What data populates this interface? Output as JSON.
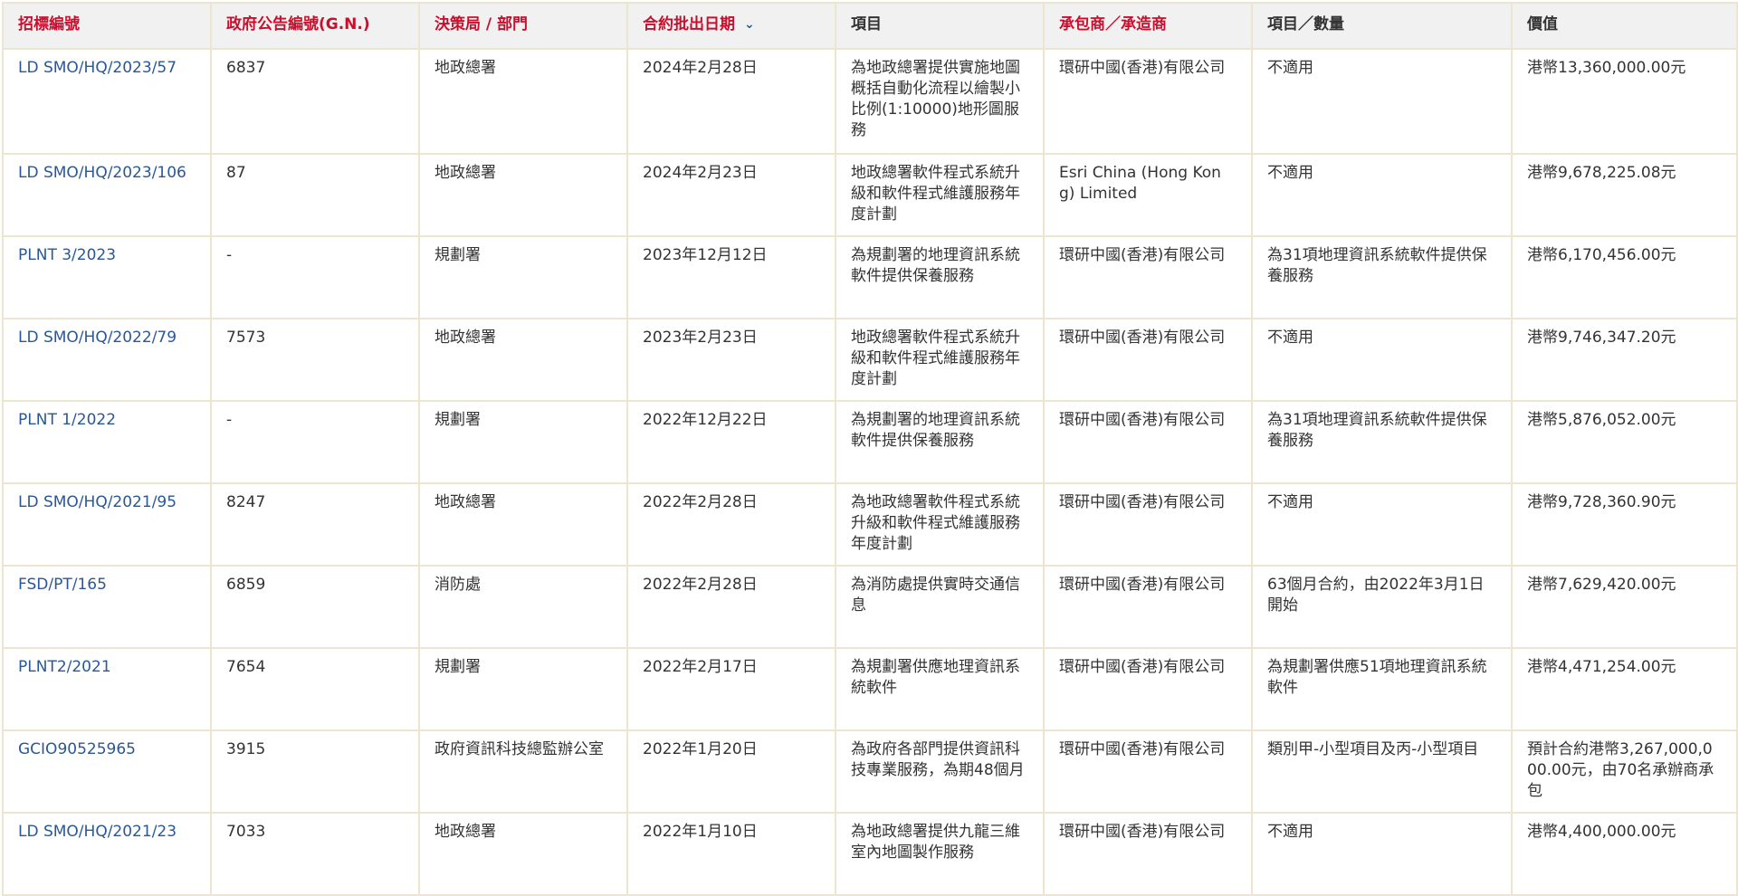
{
  "columns": [
    {
      "label": "招標編號",
      "color": "red"
    },
    {
      "label": "政府公告編號(G.N.)",
      "color": "red"
    },
    {
      "label": "決策局 / 部門",
      "color": "red"
    },
    {
      "label": "合約批出日期",
      "color": "red",
      "sort": "desc"
    },
    {
      "label": "項目",
      "color": "dark"
    },
    {
      "label": "承包商／承造商",
      "color": "red"
    },
    {
      "label": "項目／數量",
      "color": "dark"
    },
    {
      "label": "價值",
      "color": "dark"
    }
  ],
  "sort_indicator": "⌄",
  "rows": [
    [
      "LD SMO/HQ/2023/57",
      "6837",
      "地政總署",
      "2024年2月28日",
      "為地政總署提供實施地圖概括自動化流程以繪製小比例(1:10000)地形圖服務",
      "環研中國(香港)有限公司",
      "不適用",
      "港幣13,360,000.00元"
    ],
    [
      "LD SMO/HQ/2023/106",
      "87",
      "地政總署",
      "2024年2月23日",
      "地政總署軟件程式系統升級和軟件程式維護服務年度計劃",
      "Esri China (Hong Kong) Limited",
      "不適用",
      "港幣9,678,225.08元"
    ],
    [
      "PLNT 3/2023",
      "-",
      "規劃署",
      "2023年12月12日",
      "為規劃署的地理資訊系統軟件提供保養服務",
      "環研中國(香港)有限公司",
      "為31項地理資訊系統軟件提供保養服務",
      "港幣6,170,456.00元"
    ],
    [
      "LD SMO/HQ/2022/79",
      "7573",
      "地政總署",
      "2023年2月23日",
      "地政總署軟件程式系統升級和軟件程式維護服務年度計劃",
      "環研中國(香港)有限公司",
      "不適用",
      "港幣9,746,347.20元"
    ],
    [
      "PLNT 1/2022",
      "-",
      "規劃署",
      "2022年12月22日",
      "為規劃署的地理資訊系統軟件提供保養服務",
      "環研中國(香港)有限公司",
      "為31項地理資訊系統軟件提供保養服務",
      "港幣5,876,052.00元"
    ],
    [
      "LD SMO/HQ/2021/95",
      "8247",
      "地政總署",
      "2022年2月28日",
      "為地政總署軟件程式系統升級和軟件程式維護服務年度計劃",
      "環研中國(香港)有限公司",
      "不適用",
      "港幣9,728,360.90元"
    ],
    [
      "FSD/PT/165",
      "6859",
      "消防處",
      "2022年2月28日",
      "為消防處提供實時交通信息",
      "環研中國(香港)有限公司",
      "63個月合約，由2022年3月1日開始",
      "港幣7,629,420.00元"
    ],
    [
      "PLNT2/2021",
      "7654",
      "規劃署",
      "2022年2月17日",
      "為規劃署供應地理資訊系統軟件",
      "環研中國(香港)有限公司",
      "為規劃署供應51項地理資訊系統軟件",
      "港幣4,471,254.00元"
    ],
    [
      "GCIO90525965",
      "3915",
      "政府資訊科技總監辦公室",
      "2022年1月20日",
      "為政府各部門提供資訊科技專業服務，為期48個月",
      "環研中國(香港)有限公司",
      "類別甲-小型項目及丙-小型項目",
      "預計合約港幣3,267,000,000.00元，由70名承辦商承包"
    ],
    [
      "LD SMO/HQ/2021/23",
      "7033",
      "地政總署",
      "2022年1月10日",
      "為地政總署提供九龍三維室內地圖製作服務",
      "環研中國(香港)有限公司",
      "不適用",
      "港幣4,400,000.00元"
    ]
  ]
}
